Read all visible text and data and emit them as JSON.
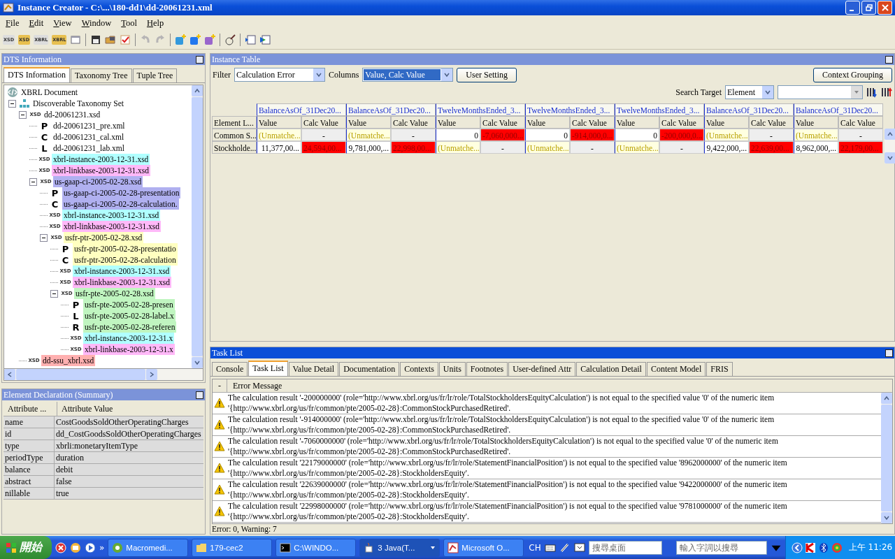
{
  "window": {
    "title": "Instance Creator - C:\\...\\180-dd1\\dd-20061231.xml"
  },
  "menu": [
    "File",
    "Edit",
    "View",
    "Window",
    "Tool",
    "Help"
  ],
  "toolbar": [
    {
      "kind": "badge",
      "label": "XSD"
    },
    {
      "kind": "badge-gold",
      "label": "XSD"
    },
    {
      "kind": "badge",
      "label": "XBRL"
    },
    {
      "kind": "badge-gold",
      "label": "XBRL"
    },
    {
      "kind": "window"
    },
    {
      "kind": "separator"
    },
    {
      "kind": "save"
    },
    {
      "kind": "folder"
    },
    {
      "kind": "check"
    },
    {
      "kind": "separator"
    },
    {
      "kind": "undo",
      "disabled": true
    },
    {
      "kind": "redo",
      "disabled": true
    },
    {
      "kind": "separator"
    },
    {
      "kind": "add",
      "color": "#3399dd"
    },
    {
      "kind": "add",
      "color": "#2277ee"
    },
    {
      "kind": "add",
      "color": "#9966cc"
    },
    {
      "kind": "separator"
    },
    {
      "kind": "tool"
    },
    {
      "kind": "separator"
    },
    {
      "kind": "dock"
    },
    {
      "kind": "undock"
    }
  ],
  "dts_panel": {
    "title": "DTS Information",
    "tabs": [
      {
        "label": "DTS Information",
        "selected": true
      },
      {
        "label": "Taxonomy Tree",
        "selected": false
      },
      {
        "label": "Tuple Tree",
        "selected": false
      }
    ],
    "tree": {
      "root": "XBRL Document",
      "items": [
        {
          "label": "Discoverable Taxonomy Set",
          "kind": "dts",
          "expanded": true,
          "children": [
            {
              "label": "dd-20061231.xsd",
              "kind": "file",
              "badge": "XSD",
              "expanded": true,
              "children": [
                {
                  "label": "dd-20061231_pre.xml",
                  "kind": "file",
                  "badge": "P"
                },
                {
                  "label": "dd-20061231_cal.xml",
                  "kind": "file",
                  "badge": "C"
                },
                {
                  "label": "dd-20061231_lab.xml",
                  "kind": "file",
                  "badge": "L"
                },
                {
                  "label": "xbrl-instance-2003-12-31.xsd",
                  "kind": "file",
                  "badge": "XSD",
                  "color": "#b0ffff"
                },
                {
                  "label": "xbrl-linkbase-2003-12-31.xsd",
                  "kind": "file",
                  "badge": "XSD",
                  "color": "#ffb8f8"
                },
                {
                  "label": "us-gaap-ci-2005-02-28.xsd",
                  "kind": "file",
                  "badge": "XSD",
                  "color": "#b0b0f0",
                  "expanded": true,
                  "children": [
                    {
                      "label": "us-gaap-ci-2005-02-28-presentation",
                      "kind": "file",
                      "badge": "P",
                      "color": "#b0b0f0"
                    },
                    {
                      "label": "us-gaap-ci-2005-02-28-calculation.",
                      "kind": "file",
                      "badge": "C",
                      "color": "#b0b0f0"
                    },
                    {
                      "label": "xbrl-instance-2003-12-31.xsd",
                      "kind": "file",
                      "badge": "XSD",
                      "color": "#b0ffff"
                    },
                    {
                      "label": "xbrl-linkbase-2003-12-31.xsd",
                      "kind": "file",
                      "badge": "XSD",
                      "color": "#ffb8f8"
                    },
                    {
                      "label": "usfr-ptr-2005-02-28.xsd",
                      "kind": "file",
                      "badge": "XSD",
                      "color": "#ffffc0",
                      "expanded": true,
                      "children": [
                        {
                          "label": "usfr-ptr-2005-02-28-presentatio",
                          "kind": "file",
                          "badge": "P",
                          "color": "#ffffc0"
                        },
                        {
                          "label": "usfr-ptr-2005-02-28-calculation",
                          "kind": "file",
                          "badge": "C",
                          "color": "#ffffc0"
                        },
                        {
                          "label": "xbrl-instance-2003-12-31.xsd",
                          "kind": "file",
                          "badge": "XSD",
                          "color": "#b0ffff"
                        },
                        {
                          "label": "xbrl-linkbase-2003-12-31.xsd",
                          "kind": "file",
                          "badge": "XSD",
                          "color": "#ffb8f8"
                        },
                        {
                          "label": "usfr-pte-2005-02-28.xsd",
                          "kind": "file",
                          "badge": "XSD",
                          "color": "#c0f5c0",
                          "expanded": true,
                          "children": [
                            {
                              "label": "usfr-pte-2005-02-28-presen",
                              "kind": "file",
                              "badge": "P",
                              "color": "#c0f5c0"
                            },
                            {
                              "label": "usfr-pte-2005-02-28-label.x",
                              "kind": "file",
                              "badge": "L",
                              "color": "#c0f5c0"
                            },
                            {
                              "label": "usfr-pte-2005-02-28-referen",
                              "kind": "file",
                              "badge": "R",
                              "color": "#c0f5c0"
                            },
                            {
                              "label": "xbrl-instance-2003-12-31.x",
                              "kind": "file",
                              "badge": "XSD",
                              "color": "#b0ffff"
                            },
                            {
                              "label": "xbrl-linkbase-2003-12-31.x",
                              "kind": "file",
                              "badge": "XSD",
                              "color": "#ffb8f8"
                            }
                          ]
                        }
                      ]
                    }
                  ]
                }
              ]
            },
            {
              "label": "dd-ssu_xbrl.xsd",
              "kind": "file",
              "badge": "XSD",
              "color": "#ffb0b0"
            }
          ]
        }
      ]
    }
  },
  "element_panel": {
    "title": "Element Declaration (Summary)",
    "columns": [
      "Attribute ...",
      "Attribute Value"
    ],
    "rows": [
      [
        "name",
        "CostGoodsSoldOtherOperatingCharges"
      ],
      [
        "id",
        "dd_CostGoodsSoldOtherOperatingCharges"
      ],
      [
        "type",
        "xbrli:monetaryItemType"
      ],
      [
        "periodType",
        "duration"
      ],
      [
        "balance",
        "debit"
      ],
      [
        "abstract",
        "false"
      ],
      [
        "nillable",
        "true"
      ]
    ]
  },
  "instance_panel": {
    "title": "Instance Table",
    "filter_label": "Filter",
    "filter": "Calculation Error",
    "columns_label": "Columns",
    "columns_value": "Value, Calc Value",
    "user_setting": "User Setting",
    "context_grouping": "Context Grouping",
    "search_label": "Search Target",
    "search_target": "Element",
    "table": {
      "corner": "Element L...",
      "groups": [
        {
          "title": "BalanceAsOf_31Dec20...",
          "subcolumns": [
            "Value",
            "Calc Value"
          ]
        },
        {
          "title": "BalanceAsOf_31Dec20...",
          "subcolumns": [
            "Value",
            "Calc Value"
          ]
        },
        {
          "title": "TwelveMonthsEnded_3...",
          "subcolumns": [
            "Value",
            "Calc Value"
          ]
        },
        {
          "title": "TwelveMonthsEnded_3...",
          "subcolumns": [
            "Value",
            "Calc Value"
          ]
        },
        {
          "title": "TwelveMonthsEnded_3...",
          "subcolumns": [
            "Value",
            "Calc Value"
          ]
        },
        {
          "title": "BalanceAsOf_31Dec20...",
          "subcolumns": [
            "Value",
            "Calc Value"
          ]
        },
        {
          "title": "BalanceAsOf_31Dec20...",
          "subcolumns": [
            "Value",
            "Calc Value"
          ]
        }
      ],
      "rows": [
        {
          "label": "Common S...",
          "cells": [
            {
              "text": "(Unmatche...",
              "kind": "unmatched"
            },
            {
              "text": "-",
              "kind": "empty"
            },
            {
              "text": "(Unmatche...",
              "kind": "unmatched"
            },
            {
              "text": "-",
              "kind": "empty"
            },
            {
              "text": "0",
              "kind": "value"
            },
            {
              "text": "-7,060,000...",
              "kind": "error"
            },
            {
              "text": "0",
              "kind": "value"
            },
            {
              "text": "-914,000,0...",
              "kind": "error"
            },
            {
              "text": "0",
              "kind": "value"
            },
            {
              "text": "-200,000,0...",
              "kind": "error"
            },
            {
              "text": "(Unmatche...",
              "kind": "unmatched"
            },
            {
              "text": "-",
              "kind": "empty"
            },
            {
              "text": "(Unmatche...",
              "kind": "unmatched"
            },
            {
              "text": "-",
              "kind": "empty"
            }
          ]
        },
        {
          "label": "Stockholde...",
          "cells": [
            {
              "text": "11,377,00...",
              "kind": "value"
            },
            {
              "text": "24,594,00...",
              "kind": "error"
            },
            {
              "text": "9,781,000,...",
              "kind": "value"
            },
            {
              "text": "22,998,00...",
              "kind": "error"
            },
            {
              "text": "(Unmatche...",
              "kind": "unmatched"
            },
            {
              "text": "-",
              "kind": "empty"
            },
            {
              "text": "(Unmatche...",
              "kind": "unmatched"
            },
            {
              "text": "-",
              "kind": "empty"
            },
            {
              "text": "(Unmatche...",
              "kind": "unmatched"
            },
            {
              "text": "-",
              "kind": "empty"
            },
            {
              "text": "9,422,000,...",
              "kind": "value"
            },
            {
              "text": "22,639,00...",
              "kind": "error"
            },
            {
              "text": "8,962,000,...",
              "kind": "value"
            },
            {
              "text": "22,179,00...",
              "kind": "error"
            }
          ]
        }
      ]
    }
  },
  "task_panel": {
    "title": "Task List",
    "tabs": [
      {
        "label": "Console",
        "selected": false
      },
      {
        "label": "Task List",
        "selected": true
      },
      {
        "label": "Value Detail",
        "selected": false
      },
      {
        "label": "Documentation",
        "selected": false
      },
      {
        "label": "Contexts",
        "selected": false
      },
      {
        "label": "Units",
        "selected": false
      },
      {
        "label": "Footnotes",
        "selected": false
      },
      {
        "label": "User-defined Attr",
        "selected": false
      },
      {
        "label": "Calculation Detail",
        "selected": false
      },
      {
        "label": "Content Model",
        "selected": false
      },
      {
        "label": "FRIS",
        "selected": false
      }
    ],
    "columns": [
      "-",
      "Error Message"
    ],
    "messages": [
      {
        "kind": "warning",
        "text": "The calculation result '-200000000' (role='http://www.xbrl.org/us/fr/lr/role/TotalStockholdersEquityCalculation') is not equal to the specified value '0' of the numeric item '{http://www.xbrl.org/us/fr/common/pte/2005-02-28}:CommonStockPurchasedRetired'."
      },
      {
        "kind": "warning",
        "text": "The calculation result '-914000000' (role='http://www.xbrl.org/us/fr/lr/role/TotalStockholdersEquityCalculation') is not equal to the specified value '0' of the numeric item '{http://www.xbrl.org/us/fr/common/pte/2005-02-28}:CommonStockPurchasedRetired'."
      },
      {
        "kind": "warning",
        "text": "The calculation result '-7060000000' (role='http://www.xbrl.org/us/fr/lr/role/TotalStockholdersEquityCalculation') is not equal to the specified value '0' of the numeric item '{http://www.xbrl.org/us/fr/common/pte/2005-02-28}:CommonStockPurchasedRetired'."
      },
      {
        "kind": "warning",
        "text": "The calculation result '22179000000' (role='http://www.xbrl.org/us/fr/lr/role/StatementFinancialPosition') is not equal to the specified value '8962000000' of the numeric item '{http://www.xbrl.org/us/fr/common/pte/2005-02-28}:StockholdersEquity'."
      },
      {
        "kind": "warning",
        "text": "The calculation result '22639000000' (role='http://www.xbrl.org/us/fr/lr/role/StatementFinancialPosition') is not equal to the specified value '9422000000' of the numeric item '{http://www.xbrl.org/us/fr/common/pte/2005-02-28}:StockholdersEquity'."
      },
      {
        "kind": "warning",
        "text": "The calculation result '22998000000' (role='http://www.xbrl.org/us/fr/lr/role/StatementFinancialPosition') is not equal to the specified value '9781000000' of the numeric item '{http://www.xbrl.org/us/fr/common/pte/2005-02-28}:StockholdersEquity'."
      }
    ],
    "status": "Error: 0, Warning: 7"
  },
  "taskbar": {
    "start": "開始",
    "quick_launch": [
      {
        "kind": "stop"
      },
      {
        "kind": "mail"
      },
      {
        "kind": "media"
      }
    ],
    "more": "»",
    "tasks": [
      {
        "label": "Macromedi...",
        "kind": "app",
        "selected": false
      },
      {
        "label": "179-cec2",
        "kind": "folder",
        "selected": false
      },
      {
        "label": "C:\\WINDO...",
        "kind": "console",
        "selected": false
      },
      {
        "label": "3 Java(T...",
        "kind": "java",
        "selected": true
      },
      {
        "label": "Microsoft O...",
        "kind": "office",
        "selected": false
      }
    ],
    "language": "CH",
    "desktop_search": {
      "placeholder": "搜尋桌面"
    },
    "web_search": {
      "placeholder": "輸入字詞以搜尋"
    },
    "clock": "上午 11:26"
  }
}
